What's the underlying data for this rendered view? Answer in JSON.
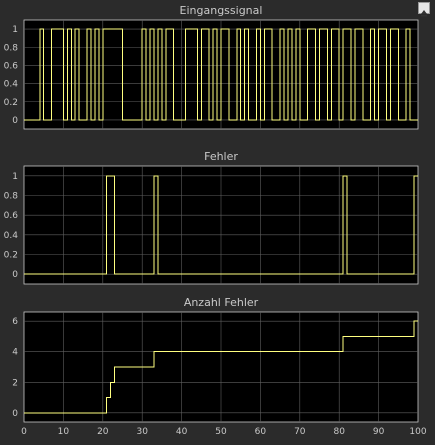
{
  "window": {
    "undock_icon": "undock-arrow-icon"
  },
  "colors": {
    "background": "#2b2b2b",
    "axes_background": "#000000",
    "grid": "#5f5f5f",
    "text": "#c9c9c9",
    "signal": "#ffff80"
  },
  "chart_data": [
    {
      "type": "line",
      "title": "Eingangssignal",
      "xlim": [
        0,
        100
      ],
      "ylim": [
        -0.1,
        1.1
      ],
      "yticks": [
        "0",
        "0.2",
        "0.4",
        "0.6",
        "0.8",
        "1"
      ],
      "grid": true,
      "step": true,
      "series": [
        {
          "x": [
            0,
            4,
            4,
            5,
            5,
            7,
            7,
            10,
            10,
            11,
            11,
            12,
            12,
            13,
            13,
            14,
            14,
            16,
            16,
            17,
            17,
            18,
            18,
            19,
            19,
            20,
            20,
            25,
            25,
            30,
            30,
            31,
            31,
            32,
            32,
            33,
            33,
            34,
            34,
            35,
            35,
            36,
            36,
            38,
            38,
            41,
            41,
            44,
            44,
            45,
            45,
            47,
            47,
            48,
            48,
            49,
            49,
            50,
            50,
            52,
            52,
            54,
            54,
            55,
            55,
            56,
            56,
            57,
            57,
            59,
            59,
            60,
            60,
            61,
            61,
            63,
            63,
            65,
            65,
            66,
            66,
            67,
            67,
            68,
            68,
            69,
            69,
            70,
            70,
            72,
            72,
            74,
            74,
            75,
            75,
            77,
            77,
            78,
            78,
            80,
            80,
            81,
            81,
            83,
            83,
            84,
            84,
            86,
            86,
            88,
            88,
            89,
            89,
            90,
            90,
            92,
            92,
            93,
            93,
            95,
            95,
            97,
            97,
            98,
            98,
            100
          ],
          "y": [
            0,
            0,
            1,
            1,
            0,
            0,
            1,
            1,
            0,
            0,
            1,
            1,
            0,
            0,
            1,
            1,
            0,
            0,
            1,
            1,
            0,
            0,
            1,
            1,
            0,
            0,
            1,
            1,
            0,
            0,
            1,
            1,
            0,
            0,
            1,
            1,
            0,
            0,
            1,
            1,
            0,
            0,
            1,
            1,
            0,
            0,
            1,
            1,
            0,
            0,
            1,
            1,
            0,
            0,
            1,
            1,
            0,
            0,
            1,
            1,
            0,
            0,
            1,
            1,
            0,
            0,
            1,
            1,
            0,
            0,
            1,
            1,
            0,
            0,
            1,
            1,
            0,
            0,
            1,
            1,
            0,
            0,
            1,
            1,
            0,
            0,
            1,
            1,
            0,
            0,
            1,
            1,
            0,
            0,
            1,
            1,
            0,
            0,
            1,
            1,
            0,
            0,
            1,
            1,
            0,
            0,
            1,
            1,
            0,
            0,
            1,
            1,
            0,
            0,
            1,
            1,
            0,
            0,
            1,
            1,
            0,
            0,
            1,
            1,
            0,
            0
          ]
        }
      ]
    },
    {
      "type": "line",
      "title": "Fehler",
      "xlim": [
        0,
        100
      ],
      "ylim": [
        -0.1,
        1.1
      ],
      "yticks": [
        "0",
        "0.2",
        "0.4",
        "0.6",
        "0.8",
        "1"
      ],
      "grid": true,
      "step": true,
      "series": [
        {
          "x": [
            0,
            21,
            21,
            23,
            23,
            33,
            33,
            34,
            34,
            81,
            81,
            82,
            82,
            99,
            99,
            100
          ],
          "y": [
            0,
            0,
            1,
            1,
            0,
            0,
            1,
            1,
            0,
            0,
            1,
            1,
            0,
            0,
            1,
            1
          ]
        }
      ]
    },
    {
      "type": "line",
      "title": "Anzahl Fehler",
      "xlim": [
        0,
        100
      ],
      "ylim": [
        -0.6,
        6.6
      ],
      "yticks": [
        "0",
        "2",
        "4",
        "6"
      ],
      "xticks": [
        "0",
        "10",
        "20",
        "30",
        "40",
        "50",
        "60",
        "70",
        "80",
        "90",
        "100"
      ],
      "grid": true,
      "step": true,
      "series": [
        {
          "x": [
            0,
            21,
            21,
            22,
            22,
            23,
            23,
            33,
            33,
            81,
            81,
            99,
            99,
            100
          ],
          "y": [
            0,
            0,
            1,
            1,
            2,
            2,
            3,
            3,
            4,
            4,
            5,
            5,
            6,
            6
          ]
        }
      ]
    }
  ]
}
